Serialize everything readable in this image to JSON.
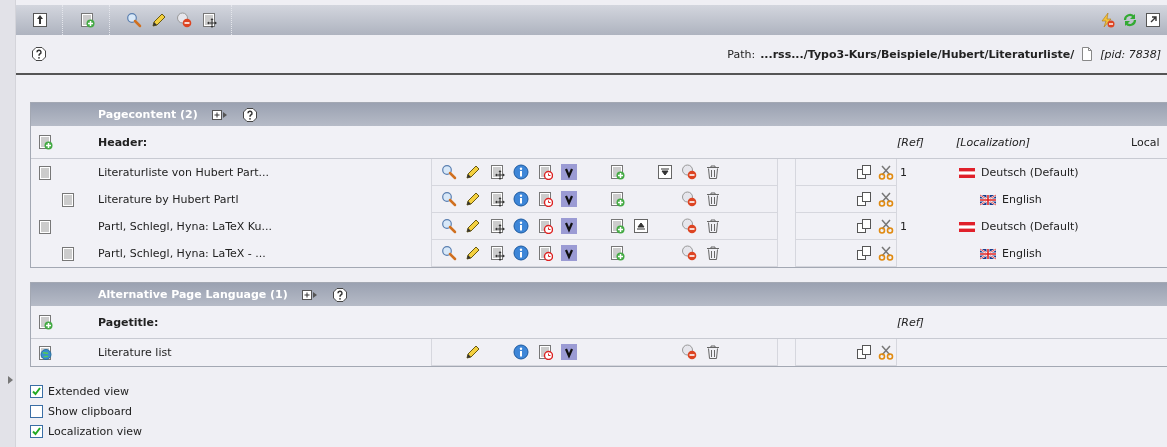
{
  "path": {
    "label": "Path:",
    "value": "...rss.../Typo3-Kurs/Beispiele/Hubert/Literaturliste/",
    "pid": "[pid: 7838]"
  },
  "sections": [
    {
      "title": "Pagecontent (2)",
      "header": "Header:",
      "columns": [
        {
          "label": "[Ref]",
          "kind": "ref"
        },
        {
          "label": "[Localization]",
          "kind": "localization"
        },
        {
          "label": "Local",
          "kind": "more"
        }
      ],
      "rows": [
        {
          "title": "Literaturliste von Hubert Part...",
          "kind": "content",
          "move_down": true,
          "move_up": false,
          "ref": "1",
          "language": {
            "label": "Deutsch (Default)",
            "kind": "at"
          },
          "children": [
            {
              "title": "Literature by Hubert Partl",
              "kind": "content",
              "move_down": false,
              "move_up": false,
              "language": {
                "label": "English",
                "kind": "gb"
              }
            }
          ]
        },
        {
          "title": "Partl, Schlegl, Hyna: LaTeX Ku...",
          "kind": "content",
          "move_down": false,
          "move_up": true,
          "ref": "1",
          "language": {
            "label": "Deutsch (Default)",
            "kind": "at"
          },
          "children": [
            {
              "title": "Partl, Schlegl, Hyna: LaTeX - ...",
              "kind": "content",
              "move_down": false,
              "move_up": false,
              "language": {
                "label": "English",
                "kind": "gb"
              }
            }
          ]
        }
      ]
    },
    {
      "title": "Alternative Page Language (1)",
      "header": "Pagetitle:",
      "columns": [
        {
          "label": "[Ref]",
          "kind": "ref"
        }
      ],
      "rows": [
        {
          "title": "Literature list",
          "kind": "page_overlay",
          "move_down": false,
          "move_up": false
        }
      ]
    }
  ],
  "options": [
    {
      "label": "Extended view",
      "checked": true
    },
    {
      "label": "Show clipboard",
      "checked": false
    },
    {
      "label": "Localization view",
      "checked": true
    }
  ]
}
